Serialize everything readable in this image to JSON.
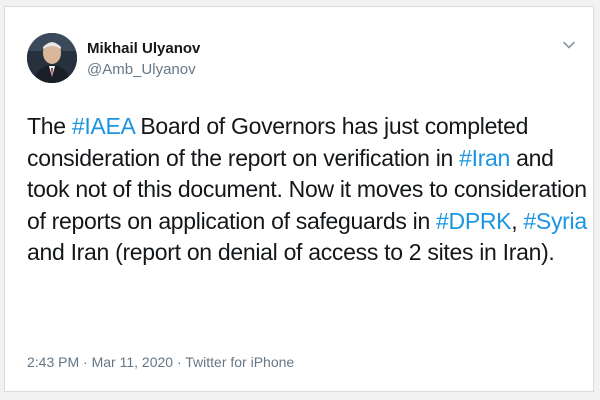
{
  "author": {
    "name": "Mikhail Ulyanov",
    "handle": "@Amb_Ulyanov"
  },
  "tweet": {
    "segments": [
      {
        "text": "The ",
        "hashtag": false
      },
      {
        "text": "#IAEA",
        "hashtag": true
      },
      {
        "text": " Board of Governors has just completed consideration of the report on verification in ",
        "hashtag": false
      },
      {
        "text": "#Iran",
        "hashtag": true
      },
      {
        "text": " and took not of this document. Now it moves to consideration of reports on application of safeguards in ",
        "hashtag": false
      },
      {
        "text": "#DPRK",
        "hashtag": true
      },
      {
        "text": ", ",
        "hashtag": false
      },
      {
        "text": "#Syria",
        "hashtag": true
      },
      {
        "text": " and Iran (report on denial of access to 2 sites in Iran).",
        "hashtag": false
      }
    ]
  },
  "meta": {
    "time": "2:43 PM",
    "separator": " · ",
    "date": "Mar 11, 2020",
    "source": "Twitter for iPhone"
  },
  "icons": {
    "menu": "chevron-down-icon"
  },
  "colors": {
    "hashtag": "#1b95e0",
    "text": "#14171a",
    "secondary": "#657786"
  }
}
